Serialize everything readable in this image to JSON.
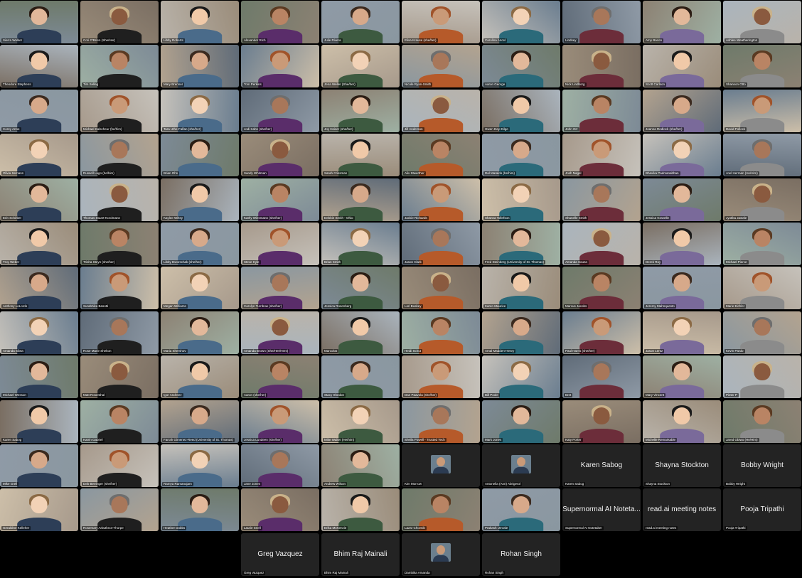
{
  "window": {
    "title": ""
  },
  "names": [
    "Sierra Walker",
    "Cori O'Brien (She/Her)",
    "Libby Roberts",
    "Alexander Rich",
    "Julie Rivera",
    "Elisa Krause (she/her)",
    "Carolina Ancel",
    "Lindsey",
    "Amy Bacon",
    "Ashlee Weatherington",
    "Theodore Stephens",
    "Tim Selleg",
    "Mary Brenner",
    "Tom Perkins",
    "Jena Weller (She/her)",
    "Nicole Ryan-Smith",
    "Aaron George",
    "Nick Lindborg",
    "Scott Carlson",
    "Shannon Otto",
    "Corey Anne",
    "Michael Kalscheur (he/him)",
    "Tara Uthe-Falfan (she/her)",
    "Jodi Kahn (she/her)",
    "Joy Heiser (she/her)",
    "Jill Anderson",
    "Gwen Day-Dilge",
    "John Orr",
    "Joanna Redlock (she/her)",
    "David Pollock",
    "Olivia Semans",
    "Russell Lugo (he/him)",
    "Brian Ohs",
    "Sandy Whitman",
    "Sarah Crissman",
    "Alix Stwerther",
    "Dal Maraldo (he/him)",
    "Josh Nagel",
    "Bhavika Padmanabhan",
    "Joel Herman (He/Him)",
    "Erin Schirber",
    "Thomas Stuart-Nordmann",
    "Kaylee Wiltsy",
    "Kathy Wiesmann (she/her)",
    "Debbie Smith - Ohio",
    "Jackie Richards",
    "Shanna Tollefson",
    "Shanelle Smith",
    "Jessica Gravelle",
    "Jyotika Jawale",
    "Troy Weber",
    "Trisha Steyn (she/her)",
    "Libby Dworschak (she/her)",
    "Steve Kyle",
    "Brian Smith",
    "Jason Clark",
    "Fred Steinberg (University of St. Thomas)",
    "Amanda Souza",
    "Derek Roy",
    "Michael Pierce",
    "Anthony LoLordo",
    "Surabhika Basotti",
    "Megan Williams",
    "Carolyn Turnbow (she/her)",
    "Jessica Rosenberg",
    "Lori Buskey",
    "Karen Maurice",
    "Marcus Jacobs",
    "Jeremy Mahnquesto",
    "Marie Eichler",
    "Amanda Sliwa",
    "Rose Marie Shelton",
    "Maria Shershov",
    "Amanda Brown (She/Her/Hers)",
    "Marcolos",
    "Heidi Schut",
    "Amal Madden-Henry",
    "Paul Harris (she/her)",
    "Jason Lentz",
    "Kevin Pardo",
    "Michael Wesson",
    "Matt Rosenthal",
    "Igor Andreev",
    "Aaron (she/her)",
    "Stacy Shedon",
    "Dan Paavola (she/her)",
    "Bill Poole",
    "Bret",
    "Mary Vincent",
    "Pieter P",
    "Karen Sabog",
    "Katrin Gabriel",
    "Farrah Gimenez-Reed (University of St. Thomas)",
    "Jessica Lundeen (she/her)",
    "Mike Walter (He/him)",
    "Sheila Powell - Trusted Tech",
    "Mark Jones",
    "Katy Porter",
    "Michelle Remarkable",
    "Jared Obiwo (He/Him)",
    "Mike Grell",
    "Deb Berringer (she/her)",
    "Ramya Ramanujam",
    "Jane Jones",
    "Andrew Wilson",
    "Kim Morrow",
    "Antonella (Ann) Abrigerol",
    "Karen Sabog",
    "Shayna Stockton",
    "Bobby Wright",
    "Geraldine Kelleher",
    "Rosemary Arbuthnot-Thorpe",
    "Heather Dobbs",
    "Laurie Snell",
    "Erika McKenzie",
    "Lazar Chovnik",
    "Prakash Umrale",
    "Supernormal AI Notetaker",
    "read.ai meeting notes",
    "Pooja Tripathi",
    "Greg Vazquez",
    "Bhim Raj Mainali",
    "Dambika Amanda",
    "Rohan Singh"
  ],
  "bigLabels": {
    "107": "Karen Sabog",
    "108": "Shayna Stockton",
    "109": "Bobby Wright",
    "117": "Supernormal AI Noteta...",
    "118": "read.ai meeting notes",
    "119": "Pooja Tripathi",
    "120": "Greg Vazquez",
    "121": "Bhim Raj Mainali",
    "123": "Rohan Singh"
  },
  "avatarTiles": [
    105,
    106,
    122
  ],
  "colors": {
    "background": "#000000",
    "tile_empty": "#232323",
    "label_text": "#ffffff"
  }
}
